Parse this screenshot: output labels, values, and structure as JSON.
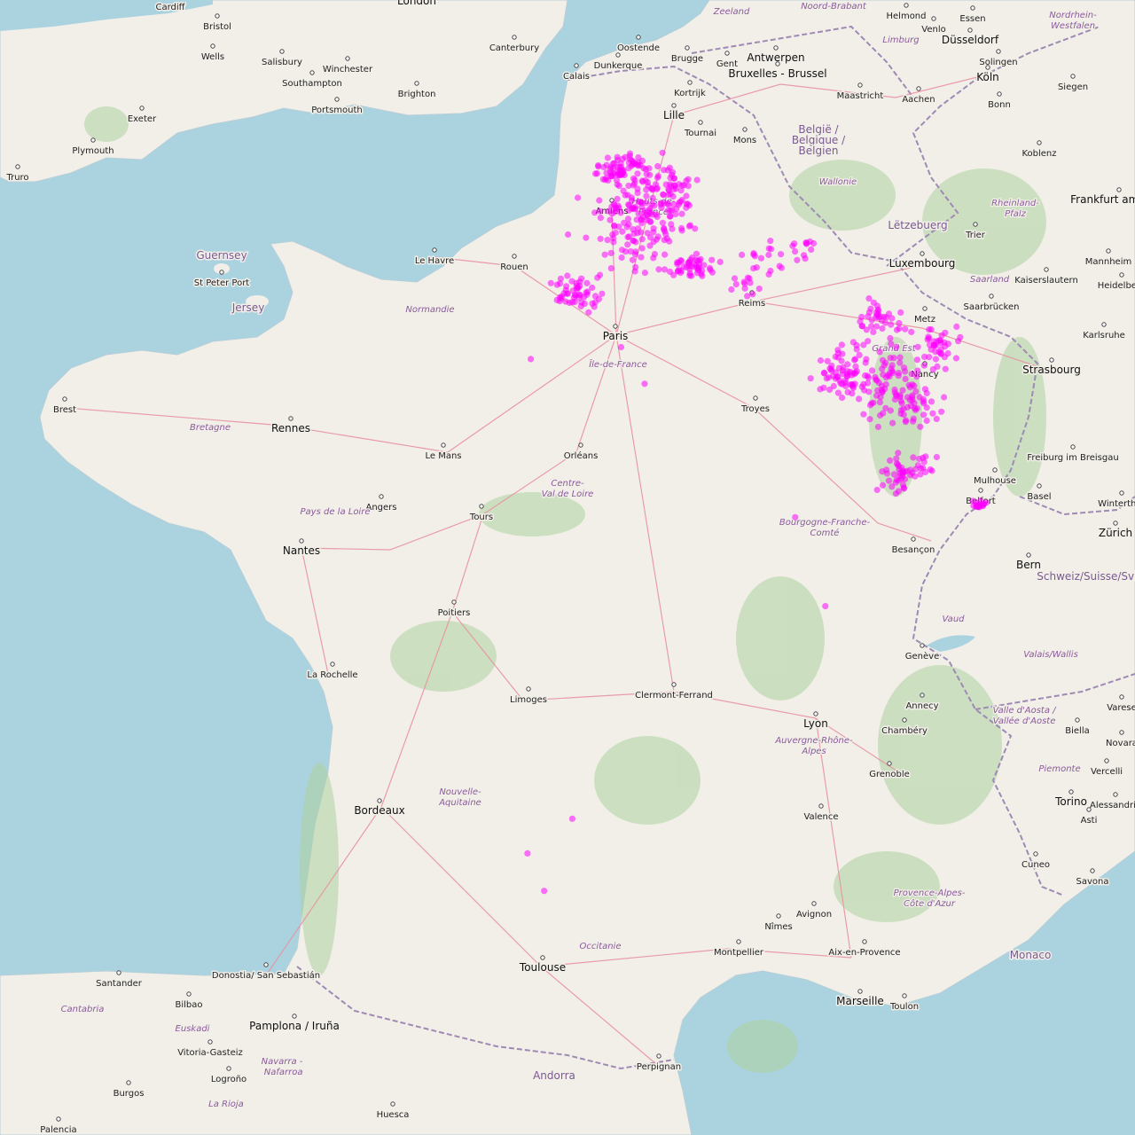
{
  "map": {
    "colors": {
      "sea": "#aad3df",
      "land": "#f2efe9",
      "forest": "#add19e",
      "road": "#e892a2",
      "border": "#9e8ab4",
      "marker": "#ff00ff"
    },
    "cities": [
      {
        "name": "Cardiff",
        "big": false
      },
      {
        "name": "London",
        "big": true
      },
      {
        "name": "Bristol",
        "big": false
      },
      {
        "name": "Wells",
        "big": false
      },
      {
        "name": "Salisbury",
        "big": false
      },
      {
        "name": "Winchester",
        "big": false
      },
      {
        "name": "Southampton",
        "big": false
      },
      {
        "name": "Portsmouth",
        "big": false
      },
      {
        "name": "Brighton",
        "big": false
      },
      {
        "name": "Canterbury",
        "big": false
      },
      {
        "name": "Exeter",
        "big": false
      },
      {
        "name": "Plymouth",
        "big": false
      },
      {
        "name": "Truro",
        "big": false
      },
      {
        "name": "St Peter Port",
        "big": false
      },
      {
        "name": "Oostende",
        "big": false
      },
      {
        "name": "Brugge",
        "big": false
      },
      {
        "name": "Gent",
        "big": false
      },
      {
        "name": "Antwerpen",
        "big": true
      },
      {
        "name": "Bruxelles - Brussel",
        "big": true
      },
      {
        "name": "Calais",
        "big": false
      },
      {
        "name": "Dunkerque",
        "big": false
      },
      {
        "name": "Kortrijk",
        "big": false
      },
      {
        "name": "Lille",
        "big": true
      },
      {
        "name": "Tournai",
        "big": false
      },
      {
        "name": "Mons",
        "big": false
      },
      {
        "name": "Maastricht",
        "big": false
      },
      {
        "name": "Aachen",
        "big": false
      },
      {
        "name": "Helmond",
        "big": false
      },
      {
        "name": "Venlo",
        "big": false
      },
      {
        "name": "Essen",
        "big": false
      },
      {
        "name": "Düsseldorf",
        "big": true
      },
      {
        "name": "Solingen",
        "big": false
      },
      {
        "name": "Köln",
        "big": true
      },
      {
        "name": "Siegen",
        "big": false
      },
      {
        "name": "Bonn",
        "big": false
      },
      {
        "name": "Koblenz",
        "big": false
      },
      {
        "name": "Frankfurt am Main",
        "big": true
      },
      {
        "name": "Trier",
        "big": false
      },
      {
        "name": "Luxembourg",
        "big": true
      },
      {
        "name": "Mannheim",
        "big": false
      },
      {
        "name": "Kaiserslautern",
        "big": false
      },
      {
        "name": "Heidelberg",
        "big": false
      },
      {
        "name": "Saarbrücken",
        "big": false
      },
      {
        "name": "Karlsruhe",
        "big": false
      },
      {
        "name": "Metz",
        "big": false
      },
      {
        "name": "Nancy",
        "big": false
      },
      {
        "name": "Strasbourg",
        "big": true
      },
      {
        "name": "Amiens",
        "big": false
      },
      {
        "name": "Le Havre",
        "big": false
      },
      {
        "name": "Rouen",
        "big": false
      },
      {
        "name": "Reims",
        "big": false
      },
      {
        "name": "Paris",
        "big": true
      },
      {
        "name": "Troyes",
        "big": false
      },
      {
        "name": "Brest",
        "big": false
      },
      {
        "name": "Rennes",
        "big": true
      },
      {
        "name": "Le Mans",
        "big": false
      },
      {
        "name": "Orléans",
        "big": false
      },
      {
        "name": "Tours",
        "big": false
      },
      {
        "name": "Angers",
        "big": false
      },
      {
        "name": "Nantes",
        "big": true
      },
      {
        "name": "Poitiers",
        "big": false
      },
      {
        "name": "La Rochelle",
        "big": false
      },
      {
        "name": "Limoges",
        "big": false
      },
      {
        "name": "Clermont-Ferrand",
        "big": false
      },
      {
        "name": "Lyon",
        "big": true
      },
      {
        "name": "Besançon",
        "big": false
      },
      {
        "name": "Mulhouse",
        "big": false
      },
      {
        "name": "Belfort",
        "big": false
      },
      {
        "name": "Basel",
        "big": false
      },
      {
        "name": "Freiburg im Breisgau",
        "big": false
      },
      {
        "name": "Zürich",
        "big": true
      },
      {
        "name": "Winterthur",
        "big": false
      },
      {
        "name": "Bern",
        "big": true
      },
      {
        "name": "Genève",
        "big": false
      },
      {
        "name": "Annecy",
        "big": false
      },
      {
        "name": "Chambéry",
        "big": false
      },
      {
        "name": "Grenoble",
        "big": false
      },
      {
        "name": "Valence",
        "big": false
      },
      {
        "name": "Biella",
        "big": false
      },
      {
        "name": "Novara",
        "big": false
      },
      {
        "name": "Varese",
        "big": false
      },
      {
        "name": "Vercelli",
        "big": false
      },
      {
        "name": "Torino",
        "big": true
      },
      {
        "name": "Alessandria",
        "big": false
      },
      {
        "name": "Asti",
        "big": false
      },
      {
        "name": "Cuneo",
        "big": false
      },
      {
        "name": "Savona",
        "big": false
      },
      {
        "name": "Bordeaux",
        "big": true
      },
      {
        "name": "Toulouse",
        "big": true
      },
      {
        "name": "Montpellier",
        "big": false
      },
      {
        "name": "Nîmes",
        "big": false
      },
      {
        "name": "Avignon",
        "big": false
      },
      {
        "name": "Aix-en-Provence",
        "big": false
      },
      {
        "name": "Marseille",
        "big": true
      },
      {
        "name": "Toulon",
        "big": false
      },
      {
        "name": "Perpignan",
        "big": false
      },
      {
        "name": "Santander",
        "big": false
      },
      {
        "name": "Bilbao",
        "big": false
      },
      {
        "name": "Donostia/ San Sebastián",
        "big": false
      },
      {
        "name": "Pamplona / Iruña",
        "big": true
      },
      {
        "name": "Vitoria-Gasteiz",
        "big": false
      },
      {
        "name": "Logroño",
        "big": false
      },
      {
        "name": "Burgos",
        "big": false
      },
      {
        "name": "Huesca",
        "big": false
      },
      {
        "name": "Palencia",
        "big": false
      }
    ],
    "regions": [
      "Zeeland",
      "Noord-Brabant",
      "Limburg",
      "Nordrhein-Westfalen",
      "Wallonie",
      "Rheinland-Pfalz",
      "Saarland",
      "Hauts-de-France",
      "Normandie",
      "Île-de-France",
      "Grand Est",
      "Bretagne",
      "Pays de la Loire",
      "Centre-Val de Loire",
      "Bourgogne-Franche-Comté",
      "Nouvelle-Aquitaine",
      "Auvergne-Rhône-Alpes",
      "Occitanie",
      "Provence-Alpes-Côte d'Azur",
      "Vaud",
      "Valais/Wallis",
      "Valle d'Aosta / Vallée d'Aoste",
      "Piemonte",
      "Cantabria",
      "Euskadi",
      "Navarra - Nafarroa",
      "La Rioja"
    ],
    "countries": [
      "België / Belgique / Belgien",
      "Lëtzebuerg",
      "Guernsey",
      "Jersey",
      "Schweiz/Suisse/Svizzera",
      "Monaco",
      "Andorra"
    ],
    "markers": {
      "color": "#ff00ff",
      "clusters": [
        {
          "name": "hauts-de-france",
          "count": 380
        },
        {
          "name": "champagne",
          "count": 40
        },
        {
          "name": "lorraine",
          "count": 260
        },
        {
          "name": "franche-comte",
          "count": 70
        }
      ],
      "isolated": [
        {
          "lat": 43.6,
          "lon": 1.05
        },
        {
          "lat": 43.22,
          "lon": 1.3
        },
        {
          "lat": 43.95,
          "lon": 1.72
        },
        {
          "lat": 47.0,
          "lon": 5.05
        },
        {
          "lat": 46.1,
          "lon": 5.5
        },
        {
          "lat": 48.72,
          "lon": 2.45
        },
        {
          "lat": 48.35,
          "lon": 2.8
        },
        {
          "lat": 48.6,
          "lon": 1.1
        }
      ]
    }
  }
}
